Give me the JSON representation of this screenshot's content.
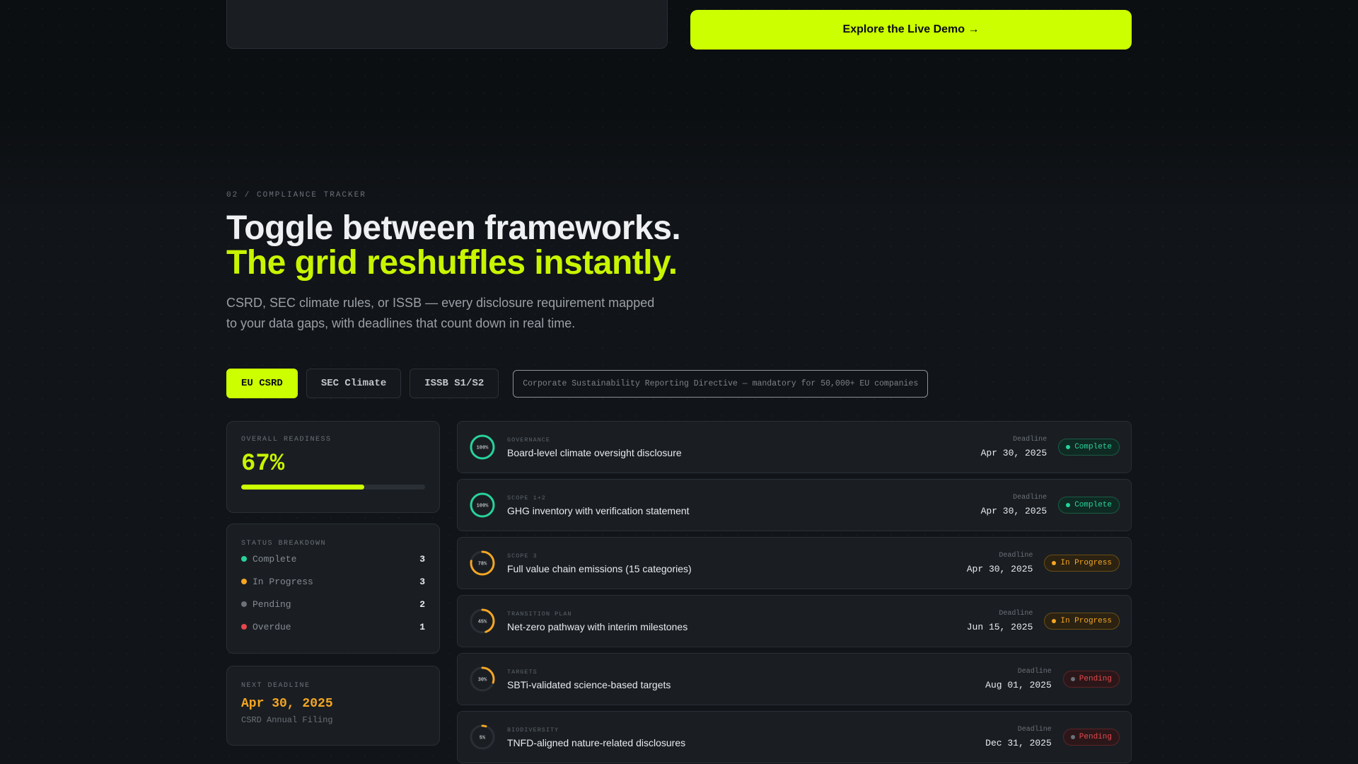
{
  "hero_cta": {
    "label": "Explore the Live Demo →"
  },
  "section": {
    "eyebrow": "02 / COMPLIANCE TRACKER",
    "headline_line1": "Toggle between frameworks.",
    "headline_line2": "The grid reshuffles instantly.",
    "subcopy": "CSRD, SEC climate rules, or ISSB — every disclosure requirement mapped to your data gaps, with deadlines that count down in real time."
  },
  "tabs": [
    {
      "label": "EU CSRD",
      "active": true
    },
    {
      "label": "SEC Climate",
      "active": false
    },
    {
      "label": "ISSB S1/S2",
      "active": false
    }
  ],
  "framework_description": "Corporate Sustainability Reporting Directive — mandatory for 50,000+ EU companies",
  "readiness": {
    "label": "OVERALL READINESS",
    "value": "67%",
    "fraction": 0.67
  },
  "breakdown": {
    "label": "STATUS BREAKDOWN",
    "rows": [
      {
        "label": "Complete",
        "count": "3",
        "color": "#27d39a"
      },
      {
        "label": "In Progress",
        "count": "3",
        "color": "#f5a623"
      },
      {
        "label": "Pending",
        "count": "2",
        "color": "#6b7178"
      },
      {
        "label": "Overdue",
        "count": "1",
        "color": "#e5484d"
      }
    ]
  },
  "next_deadline": {
    "label": "NEXT DEADLINE",
    "date": "Apr 30, 2025",
    "subtitle": "CSRD Annual Filing"
  },
  "requirements": [
    {
      "category": "GOVERNANCE",
      "title": "Board-level climate oversight disclosure",
      "progress_label": "100%",
      "progress": 1.0,
      "ring_color": "#27d39a",
      "deadline_label": "Deadline",
      "deadline": "Apr 30, 2025",
      "status": "Complete",
      "status_key": "complete"
    },
    {
      "category": "SCOPE 1+2",
      "title": "GHG inventory with verification statement",
      "progress_label": "100%",
      "progress": 1.0,
      "ring_color": "#27d39a",
      "deadline_label": "Deadline",
      "deadline": "Apr 30, 2025",
      "status": "Complete",
      "status_key": "complete"
    },
    {
      "category": "SCOPE 3",
      "title": "Full value chain emissions (15 categories)",
      "progress_label": "78%",
      "progress": 0.78,
      "ring_color": "#f5a623",
      "deadline_label": "Deadline",
      "deadline": "Apr 30, 2025",
      "status": "In Progress",
      "status_key": "progress"
    },
    {
      "category": "TRANSITION PLAN",
      "title": "Net-zero pathway with interim milestones",
      "progress_label": "45%",
      "progress": 0.45,
      "ring_color": "#f5a623",
      "deadline_label": "Deadline",
      "deadline": "Jun 15, 2025",
      "status": "In Progress",
      "status_key": "progress"
    },
    {
      "category": "TARGETS",
      "title": "SBTi-validated science-based targets",
      "progress_label": "30%",
      "progress": 0.3,
      "ring_color": "#f5a623",
      "deadline_label": "Deadline",
      "deadline": "Aug 01, 2025",
      "status": "Pending",
      "status_key": "pending"
    },
    {
      "category": "BIODIVERSITY",
      "title": "TNFD-aligned nature-related disclosures",
      "progress_label": "5%",
      "progress": 0.05,
      "ring_color": "#f5a623",
      "deadline_label": "Deadline",
      "deadline": "Dec 31, 2025",
      "status": "Pending",
      "status_key": "pending"
    }
  ]
}
